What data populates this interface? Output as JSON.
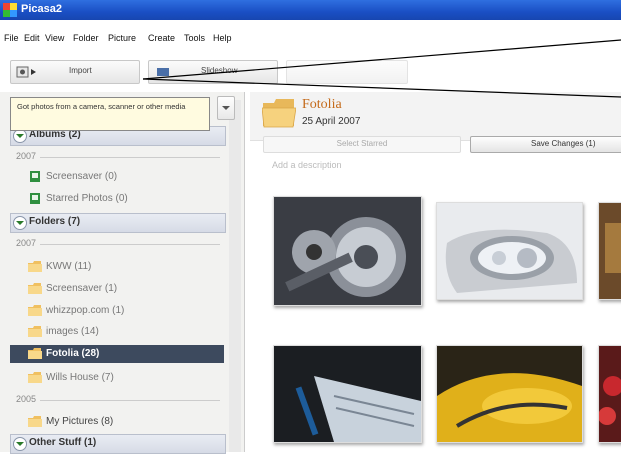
{
  "window": {
    "title": "Picasa2"
  },
  "menu": [
    "File",
    "Edit",
    "View",
    "Folder",
    "Picture",
    "Create",
    "Tools",
    "Help"
  ],
  "toolbar": {
    "import_label": "Import",
    "slideshow_label": "Slideshow"
  },
  "tooltip": "Got photos from a camera, scanner or other media",
  "sidebar": {
    "albums_header": "Albums (2)",
    "albums_year": "2007",
    "albums": [
      "Screensaver (0)",
      "Starred Photos (0)"
    ],
    "folders_header": "Folders (7)",
    "folders_year_1": "2007",
    "folders_2007": [
      "KWW (11)",
      "Screensaver (1)",
      "whizzpop.com (1)",
      "images (14)",
      "Fotolia (28)",
      "Wills House (7)"
    ],
    "folders_year_2": "2005",
    "folders_2005": [
      "My Pictures (8)"
    ],
    "other_header": "Other Stuff (1)"
  },
  "main": {
    "folder_title": "Fotolia",
    "folder_date": "25 April 2007",
    "select_starred": "Select Starred",
    "save_changes": "Save Changes (1)",
    "description_placeholder": "Add a description"
  },
  "colors": {
    "title_bar": "#1a4fc4",
    "selection": "#3d4a5e",
    "folder_title": "#c46a1a"
  }
}
